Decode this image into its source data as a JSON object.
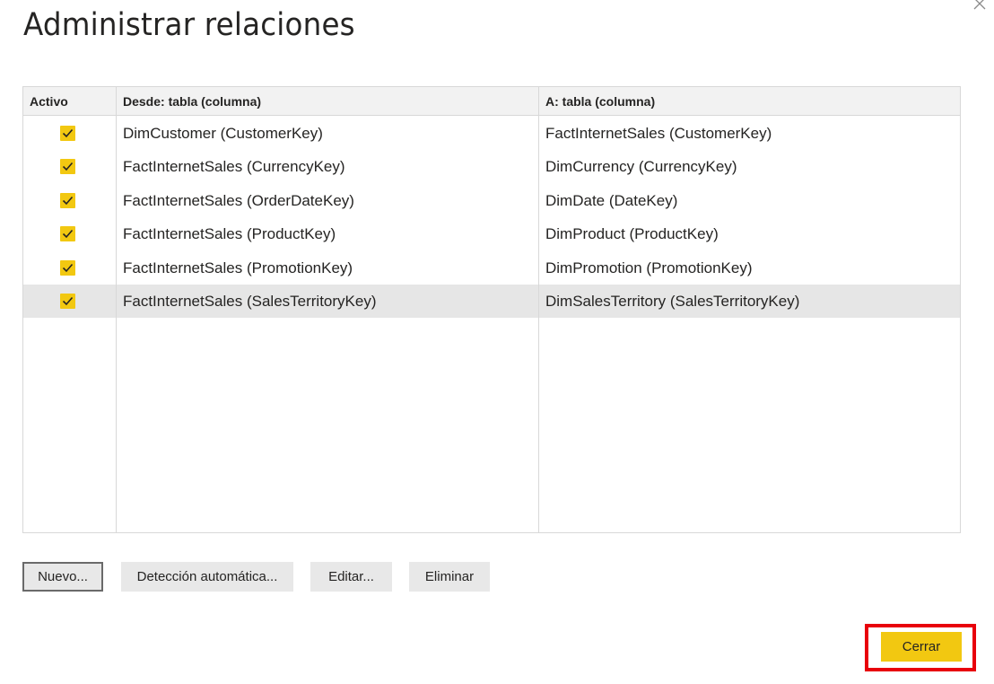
{
  "dialog": {
    "title": "Administrar relaciones",
    "close_icon": "close-icon"
  },
  "table": {
    "headers": {
      "active": "Activo",
      "from": "Desde: tabla (columna)",
      "to": "A: tabla (columna)"
    },
    "rows": [
      {
        "active": true,
        "from": "DimCustomer (CustomerKey)",
        "to": "FactInternetSales (CustomerKey)",
        "selected": false
      },
      {
        "active": true,
        "from": "FactInternetSales (CurrencyKey)",
        "to": "DimCurrency (CurrencyKey)",
        "selected": false
      },
      {
        "active": true,
        "from": "FactInternetSales (OrderDateKey)",
        "to": "DimDate (DateKey)",
        "selected": false
      },
      {
        "active": true,
        "from": "FactInternetSales (ProductKey)",
        "to": "DimProduct (ProductKey)",
        "selected": false
      },
      {
        "active": true,
        "from": "FactInternetSales (PromotionKey)",
        "to": "DimPromotion (PromotionKey)",
        "selected": false
      },
      {
        "active": true,
        "from": "FactInternetSales (SalesTerritoryKey)",
        "to": "DimSalesTerritory (SalesTerritoryKey)",
        "selected": true
      }
    ]
  },
  "actions": {
    "new": "Nuevo...",
    "autodetect": "Detección automática...",
    "edit": "Editar...",
    "delete": "Eliminar",
    "close": "Cerrar"
  },
  "colors": {
    "accent": "#f2c811",
    "highlight": "#e8000b",
    "selected_row": "#e6e6e6",
    "button_bg": "#e8e8e8"
  }
}
